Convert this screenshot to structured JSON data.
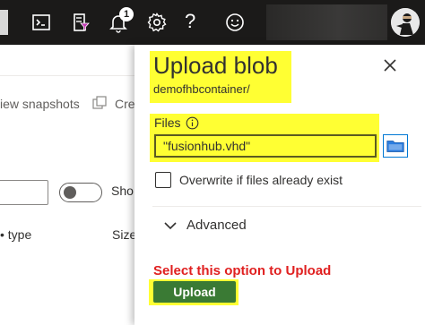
{
  "topbar": {
    "notification_count": "1",
    "help_glyph": "?",
    "icons": [
      "cloud-shell-icon",
      "directory-filter-icon",
      "bell-icon",
      "gear-icon",
      "help-icon",
      "smiley-icon",
      "avatar"
    ]
  },
  "background": {
    "snapshots_text": "iew snapshots",
    "copy_text": "Cre",
    "show_text": "Sho",
    "type_header": "type",
    "size_header": "Size"
  },
  "panel": {
    "title": "Upload blob",
    "container": "demofhbcontainer/",
    "files_label": "Files",
    "file_value": "\"fusionhub.vhd\"",
    "overwrite_label": "Overwrite if files already exist",
    "advanced_label": "Advanced",
    "annotation": "Select this option to Upload",
    "upload_label": "Upload"
  },
  "colors": {
    "topbar": "#1b1a19",
    "highlight": "#ffff33",
    "annotation": "#e02020",
    "upload_button": "#3a7a34",
    "accent": "#0078d4"
  }
}
